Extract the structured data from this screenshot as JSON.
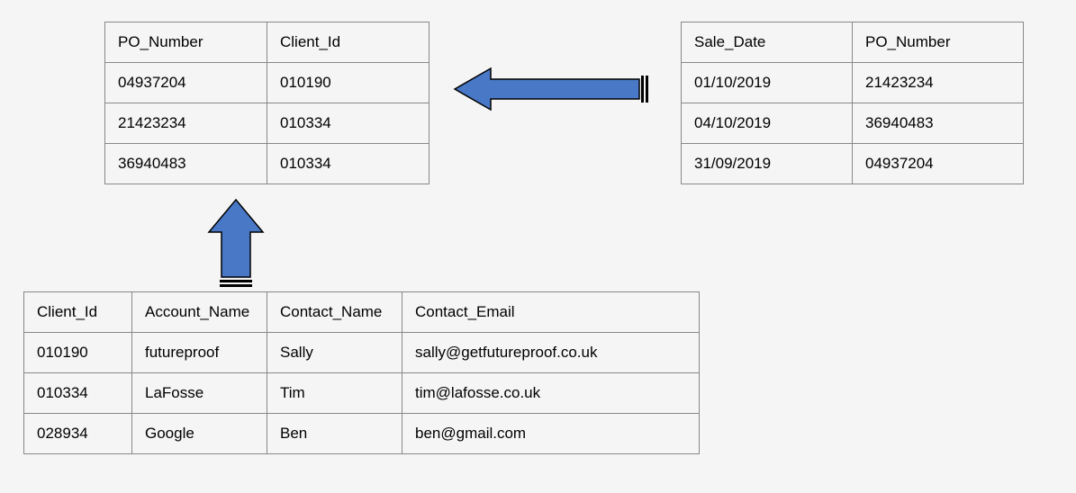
{
  "po_client_table": {
    "headers": [
      "PO_Number",
      "Client_Id"
    ],
    "rows": [
      [
        "04937204",
        "010190"
      ],
      [
        "21423234",
        "010334"
      ],
      [
        "36940483",
        "010334"
      ]
    ]
  },
  "sale_po_table": {
    "headers": [
      "Sale_Date",
      "PO_Number"
    ],
    "rows": [
      [
        "01/10/2019",
        "21423234"
      ],
      [
        "04/10/2019",
        "36940483"
      ],
      [
        "31/09/2019",
        "04937204"
      ]
    ]
  },
  "client_table": {
    "headers": [
      "Client_Id",
      "Account_Name",
      "Contact_Name",
      "Contact_Email"
    ],
    "rows": [
      [
        "010190",
        "futureproof",
        "Sally",
        "sally@getfutureproof.co.uk"
      ],
      [
        "010334",
        "LaFosse",
        "Tim",
        "tim@lafosse.co.uk"
      ],
      [
        "028934",
        "Google",
        "Ben",
        "ben@gmail.com"
      ]
    ]
  },
  "arrows": {
    "left": {
      "from": "sale_po_table",
      "to": "po_client_table"
    },
    "up": {
      "from": "client_table",
      "to": "po_client_table"
    }
  }
}
